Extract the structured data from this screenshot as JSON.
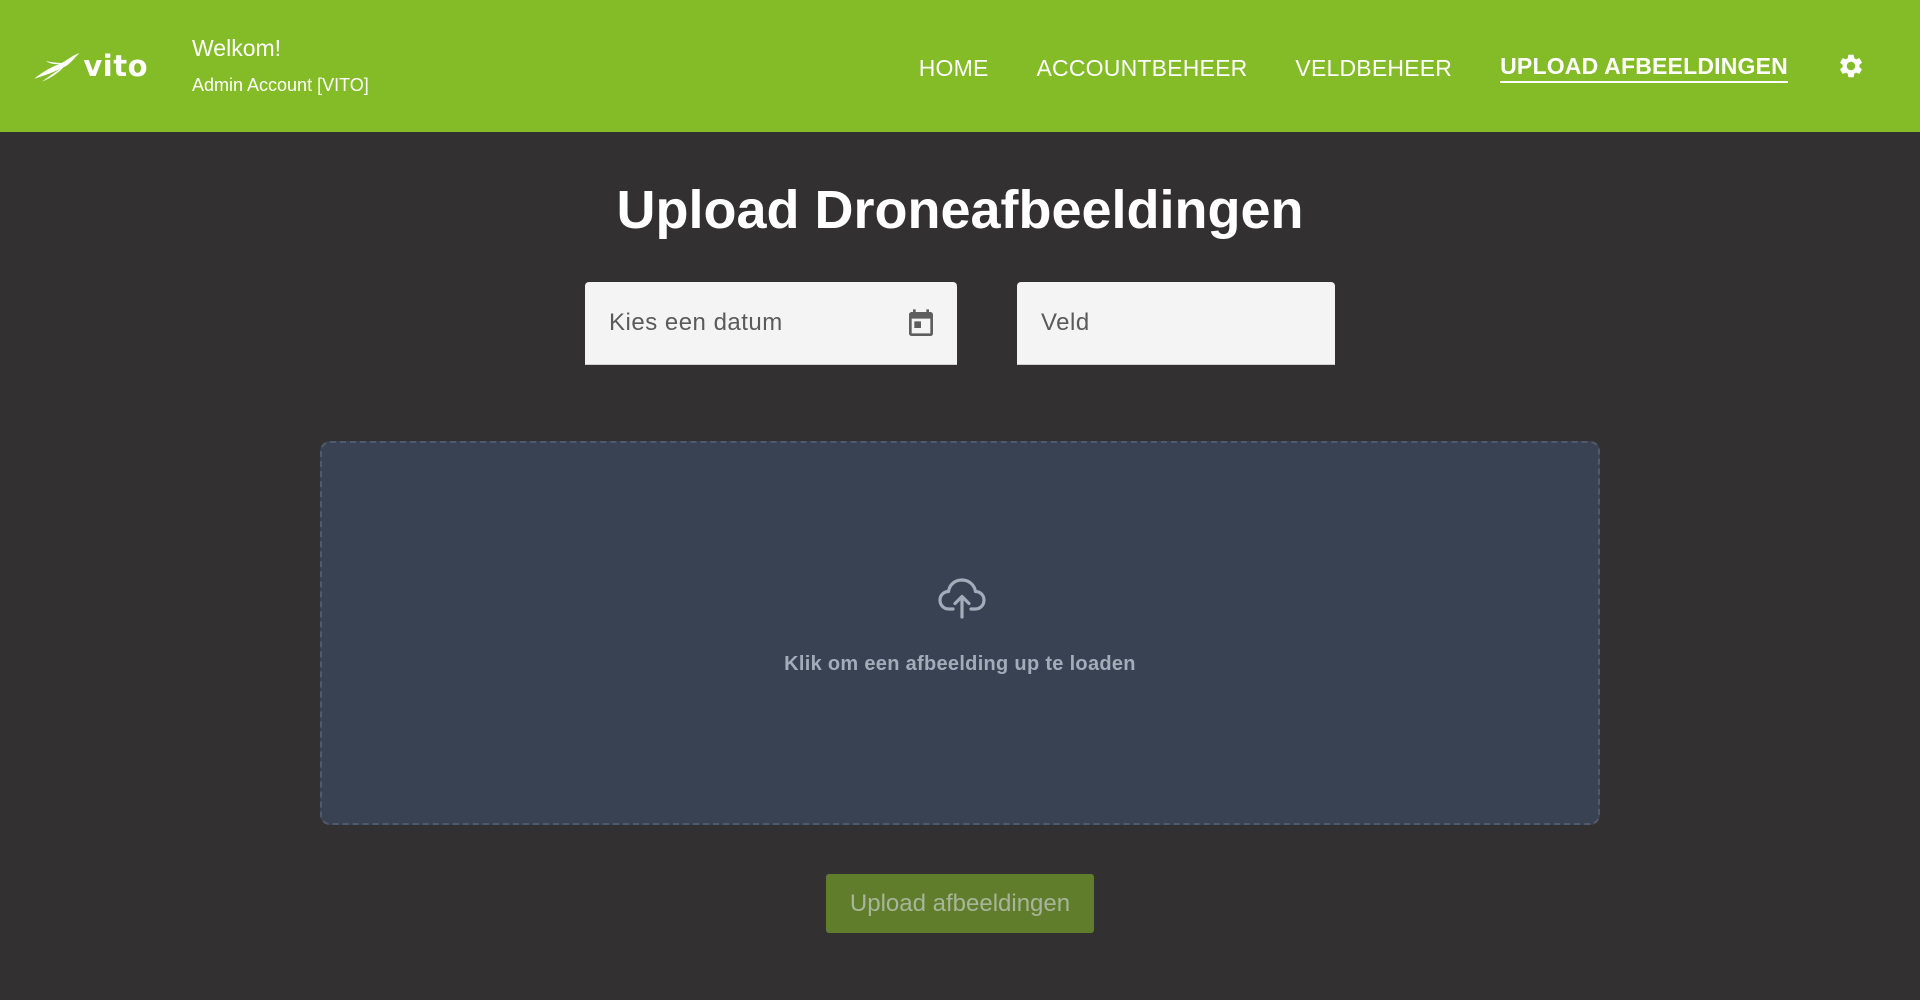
{
  "header": {
    "logo_text": "vito",
    "welcome_title": "Welkom!",
    "account": "Admin Account [VITO]",
    "nav": [
      {
        "label": "HOME"
      },
      {
        "label": "ACCOUNTBEHEER"
      },
      {
        "label": "VELDBEHEER"
      },
      {
        "label": "UPLOAD AFBEELDINGEN",
        "active": true
      }
    ],
    "settings_icon": "gear-icon"
  },
  "main": {
    "title": "Upload Droneafbeeldingen",
    "date_field": {
      "placeholder": "Kies een datum",
      "value": "",
      "icon": "calendar-icon"
    },
    "field_field": {
      "placeholder": "Veld",
      "value": ""
    },
    "dropzone": {
      "icon": "cloud-upload-icon",
      "text": "Klik om een afbeelding up te loaden"
    },
    "upload_button": "Upload afbeeldingen"
  },
  "colors": {
    "header_bg": "#83bc27",
    "page_bg": "#323031",
    "dropzone_bg": "#384253",
    "button_bg": "#5f7d2b"
  }
}
